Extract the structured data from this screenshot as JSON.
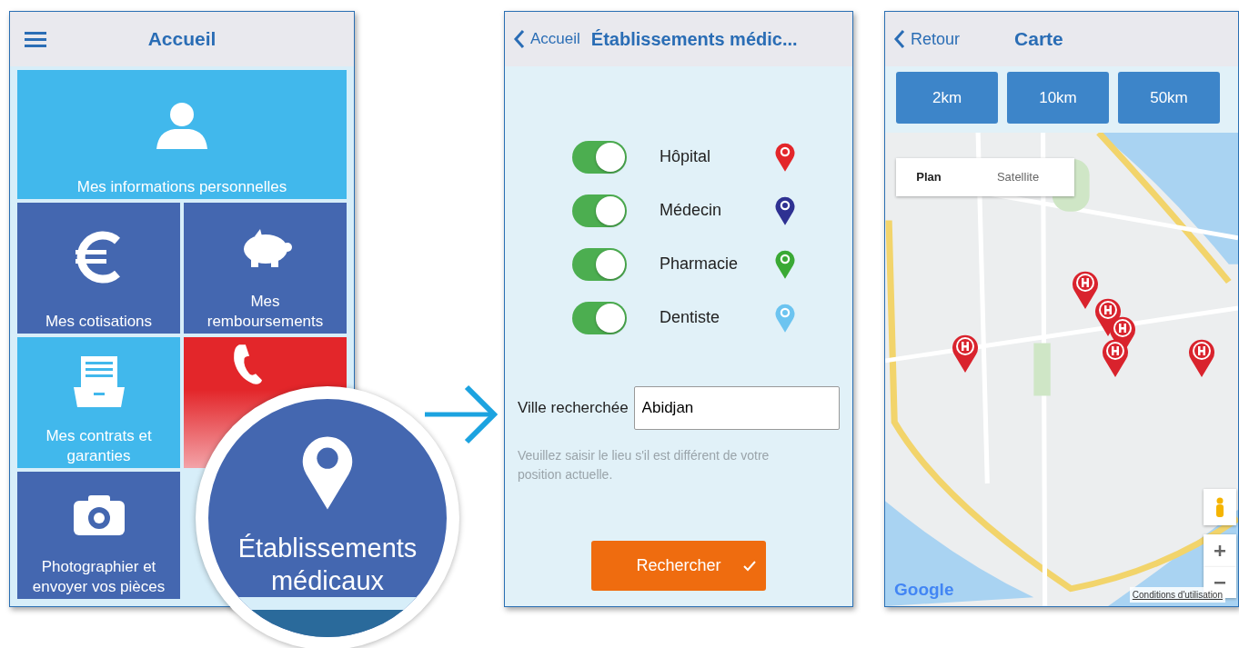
{
  "home_screen": {
    "title": "Accueil",
    "tiles": [
      {
        "kind": "user",
        "label": "Mes informations personnelles",
        "color": "#41b8ec"
      },
      {
        "kind": "euro",
        "label": "Mes cotisations",
        "color": "#4467b0"
      },
      {
        "kind": "piggy",
        "label": "Mes remboursements",
        "color": "#4467b0"
      },
      {
        "kind": "drawer",
        "label": "Mes contrats et garanties",
        "color": "#41b8ec"
      },
      {
        "kind": "phone",
        "color": "#e3262a"
      },
      {
        "kind": "camera",
        "label": "Photographier et envoyer vos pièces",
        "color": "#4467b0"
      }
    ]
  },
  "magnifier": {
    "label": "Établissements médicaux"
  },
  "search_screen": {
    "back_label": "Accueil",
    "title": "Établissements médic...",
    "filters": [
      {
        "label": "Hôpital",
        "on": true,
        "color": "#e3262a"
      },
      {
        "label": "Médecin",
        "on": true,
        "color": "#2e3192"
      },
      {
        "label": "Pharmacie",
        "on": true,
        "color": "#3aa935"
      },
      {
        "label": "Dentiste",
        "on": true,
        "color": "#6cc4f0"
      }
    ],
    "city_label": "Ville recherchée",
    "city_value": "Abidjan",
    "hint": "Veuillez saisir le lieu s'il est différent de votre position actuelle.",
    "search_button": "Rechercher"
  },
  "map_screen": {
    "back_label": "Retour",
    "title": "Carte",
    "radius_buttons": [
      "2km",
      "10km",
      "50km"
    ],
    "map_types": [
      {
        "label": "Plan",
        "selected": true
      },
      {
        "label": "Satellite",
        "selected": false
      }
    ],
    "attribution": "Google",
    "terms": "Conditions d'utilisation"
  }
}
